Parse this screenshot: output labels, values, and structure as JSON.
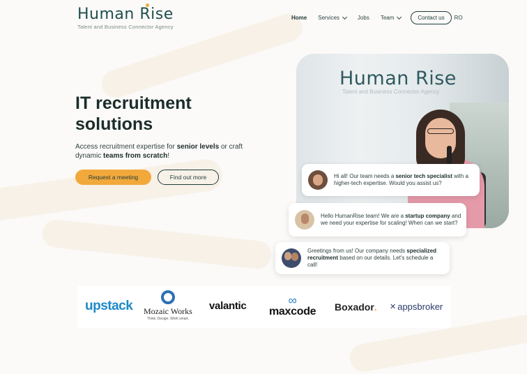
{
  "header": {
    "logo": {
      "name": "Human Rise",
      "tagline": "Talent and Business Connector Agency"
    },
    "nav": [
      {
        "label": "Home",
        "active": true,
        "dropdown": false
      },
      {
        "label": "Services",
        "active": false,
        "dropdown": true
      },
      {
        "label": "Jobs",
        "active": false,
        "dropdown": false
      },
      {
        "label": "Team",
        "active": false,
        "dropdown": true
      }
    ],
    "contact_label": "Contact us",
    "language": "RO"
  },
  "hero": {
    "headline_line1": "IT recruitment",
    "headline_line2": "solutions",
    "sub_text_1": "Access recruitment expertise for ",
    "sub_bold_1": "senior levels",
    "sub_text_2": " or craft dynamic ",
    "sub_bold_2": "teams from scratch",
    "sub_text_3": "!",
    "primary_button": "Request a meeting",
    "secondary_button": "Find out more"
  },
  "photo": {
    "sign": "Human Rise",
    "sign_sub": "Talent and Business Connector Agency"
  },
  "chat": [
    {
      "pre": "Hi all! Our team needs a ",
      "bold": "senior tech specialist",
      "post": " with a higher-tech expertise. Would you assist us?"
    },
    {
      "pre": "Hello HumanRise team! We are a ",
      "bold": "startup company",
      "post": " and we need your expertise for scaling! When can we start?"
    },
    {
      "pre": "Greetings from us! Our company needs ",
      "bold": "specialized recruitment",
      "post": " based on our details. Let's schedule a call!"
    }
  ],
  "clients": {
    "upstack": "upstack",
    "mozaic_name": "Mozaic Works",
    "mozaic_tag": "Think. Design. Work smart.",
    "valantic": "valantic",
    "maxcode": "maxcode",
    "boxador": "Boxador",
    "boxador_dot": ".",
    "appsbroker": "appsbroker"
  },
  "colors": {
    "accent": "#f2a93b",
    "primary_dark": "#1f3b3a",
    "brand_teal": "#1f4f4d"
  },
  "icons": [
    "chevron-down-icon",
    "mozaic-ring-icon",
    "maxcode-infinity-icon",
    "appsbroker-icon"
  ]
}
